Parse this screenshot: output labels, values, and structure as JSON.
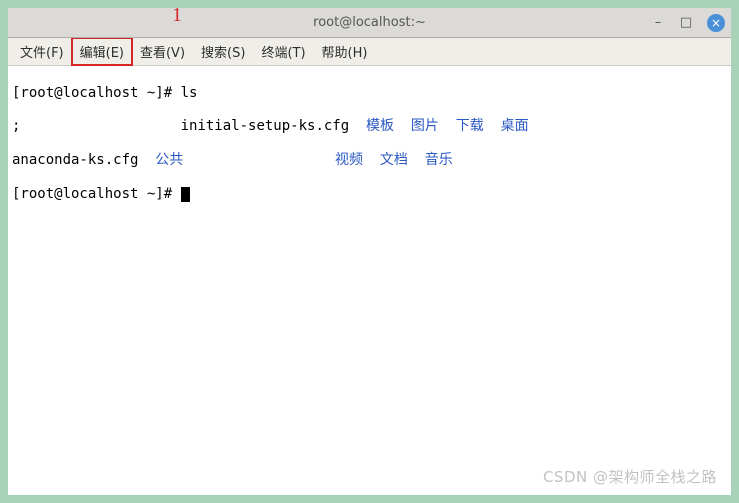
{
  "annotation": "1",
  "titlebar": {
    "title": "root@localhost:~",
    "minimize": "–",
    "maximize": "□",
    "close": "×"
  },
  "menu": {
    "file": "文件(F)",
    "edit": "编辑(E)",
    "view": "查看(V)",
    "search": "搜索(S)",
    "terminal": "终端(T)",
    "help": "帮助(H)"
  },
  "terminal": {
    "prompt1": "[root@localhost ~]# ",
    "cmd1": "ls",
    "line2_col1": ";",
    "line2_col2": "initial-setup-ks.cfg",
    "line2_b1": "模板",
    "line2_b2": "图片",
    "line2_b3": "下载",
    "line2_b4": "桌面",
    "line3_col1": "anaconda-ks.cfg",
    "line3_b0": "公共",
    "line3_b1": "视频",
    "line3_b2": "文档",
    "line3_b3": "音乐",
    "prompt2": "[root@localhost ~]# "
  },
  "watermark": "CSDN @架构师全栈之路"
}
